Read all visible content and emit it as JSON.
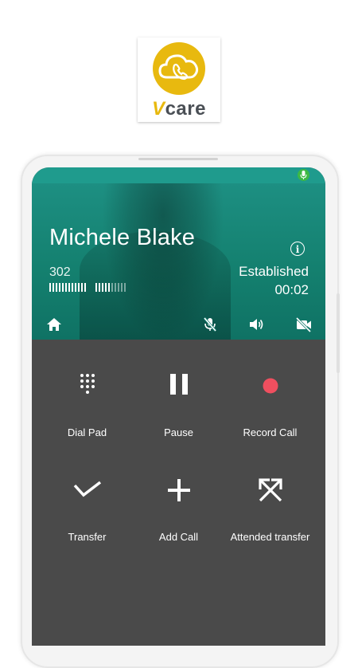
{
  "brand": {
    "logo_text": "care",
    "logo_prefix": "V",
    "accent": "#e8b90f"
  },
  "call": {
    "contact_name": "Michele Blake",
    "extension": "302",
    "status": "Established",
    "timer": "00:02"
  },
  "actions": [
    {
      "label": "Dial Pad",
      "icon": "dialpad-icon"
    },
    {
      "label": "Pause",
      "icon": "pause-icon"
    },
    {
      "label": "Record Call",
      "icon": "record-icon"
    },
    {
      "label": "Transfer",
      "icon": "transfer-icon"
    },
    {
      "label": "Add Call",
      "icon": "add-icon"
    },
    {
      "label": "Attended transfer",
      "icon": "attended-transfer-icon"
    }
  ],
  "colors": {
    "header": "#1d8f82",
    "panel": "#4a4a4a",
    "record": "#ef4f5f",
    "mic_indicator": "#3cb944"
  }
}
